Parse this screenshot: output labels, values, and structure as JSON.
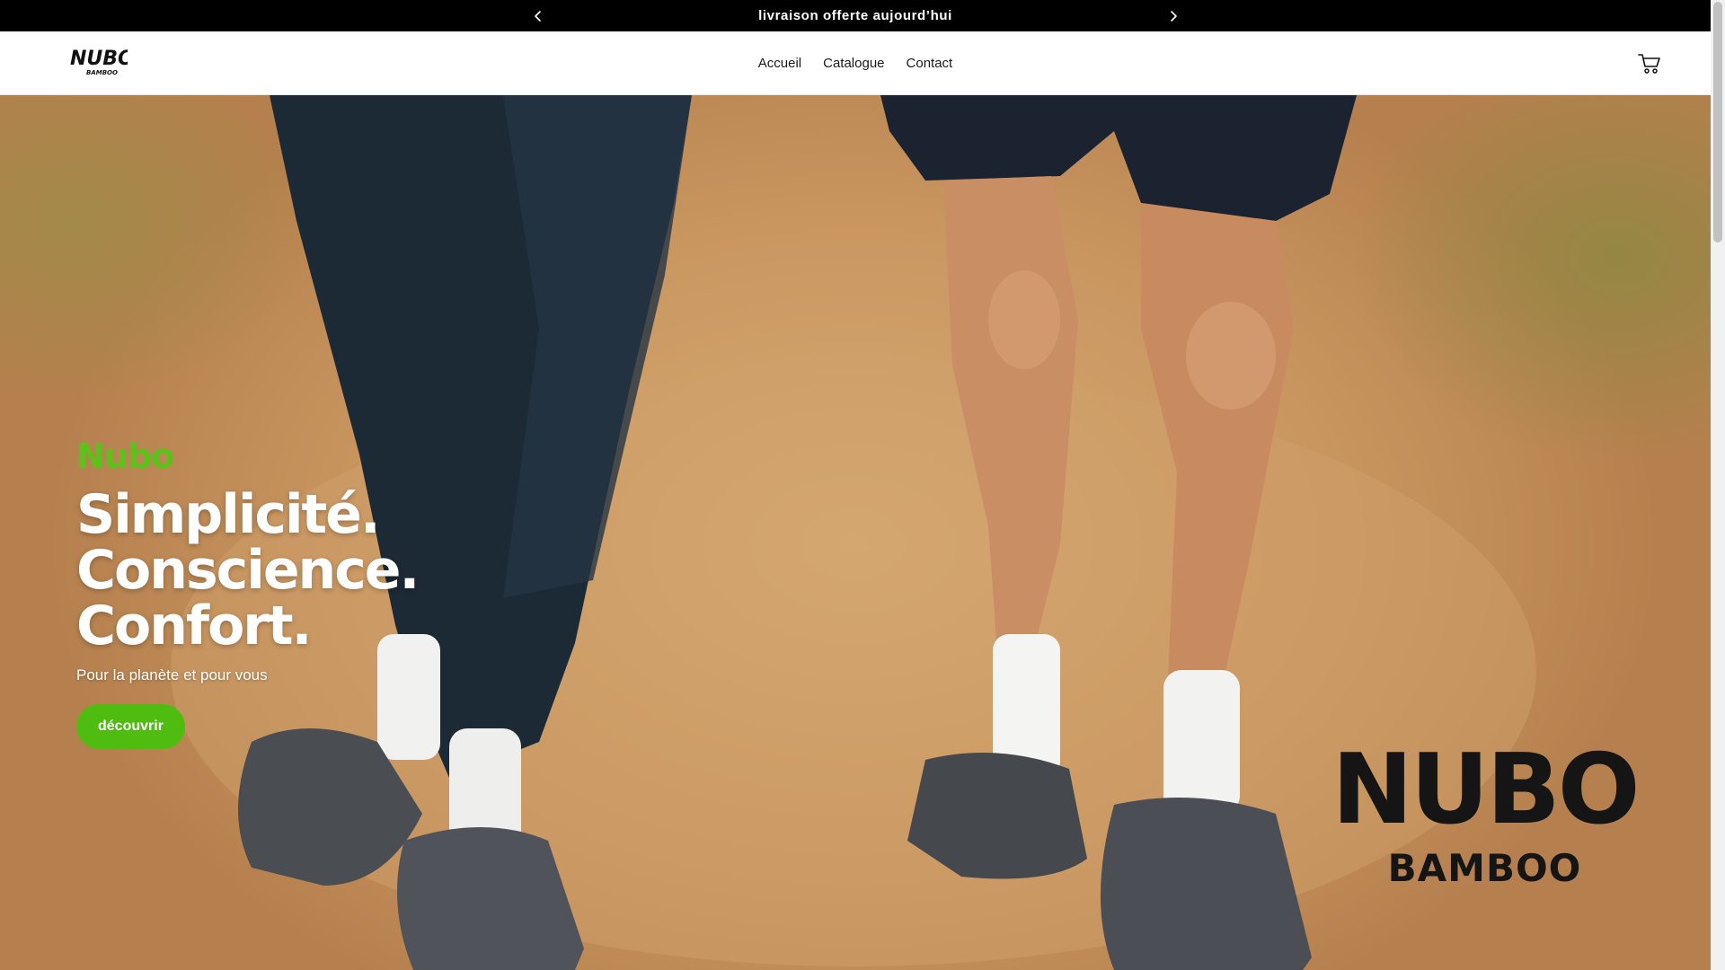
{
  "announcement": {
    "text": "livraison offerte aujourd’hui",
    "prev_icon": "chevron-left-icon",
    "next_icon": "chevron-right-icon"
  },
  "header": {
    "logo": {
      "primary": "NUBO",
      "secondary": "BAMBOO"
    },
    "nav": [
      {
        "label": "Accueil"
      },
      {
        "label": "Catalogue"
      },
      {
        "label": "Contact"
      }
    ],
    "cart_icon": "cart-icon"
  },
  "hero": {
    "eyebrow": "Nubo",
    "headline": [
      "Simplicité.",
      "Conscience.",
      "Confort."
    ],
    "subtitle": "Pour la planète et pour vous",
    "cta_label": "découvrir",
    "brand_mark": {
      "primary": "NUBO",
      "secondary": "BAMBOO"
    }
  },
  "colors": {
    "announcement_bg": "#000000",
    "accent_green": "#5bc21a",
    "cta_green": "#4fbd0f",
    "text_dark": "#1a1a1a"
  }
}
